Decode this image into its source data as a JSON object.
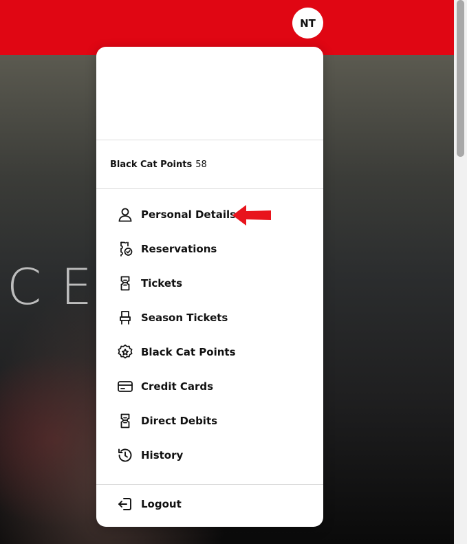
{
  "header": {
    "avatar_initials": "NT",
    "bar_color": "#e00613"
  },
  "hero": {
    "partial_text": "CE"
  },
  "menu": {
    "points": {
      "label": "Black Cat Points",
      "value": "58"
    },
    "items": [
      {
        "label": "Personal Details",
        "icon": "user-icon"
      },
      {
        "label": "Reservations",
        "icon": "reservations-icon"
      },
      {
        "label": "Tickets",
        "icon": "ticket-icon"
      },
      {
        "label": "Season Tickets",
        "icon": "seat-icon"
      },
      {
        "label": "Black Cat Points",
        "icon": "star-badge-icon"
      },
      {
        "label": "Credit Cards",
        "icon": "credit-card-icon"
      },
      {
        "label": "Direct Debits",
        "icon": "direct-debit-icon"
      },
      {
        "label": "History",
        "icon": "history-icon"
      }
    ],
    "logout": {
      "label": "Logout",
      "icon": "logout-icon"
    }
  },
  "annotation": {
    "arrow_color": "#e8141c"
  }
}
